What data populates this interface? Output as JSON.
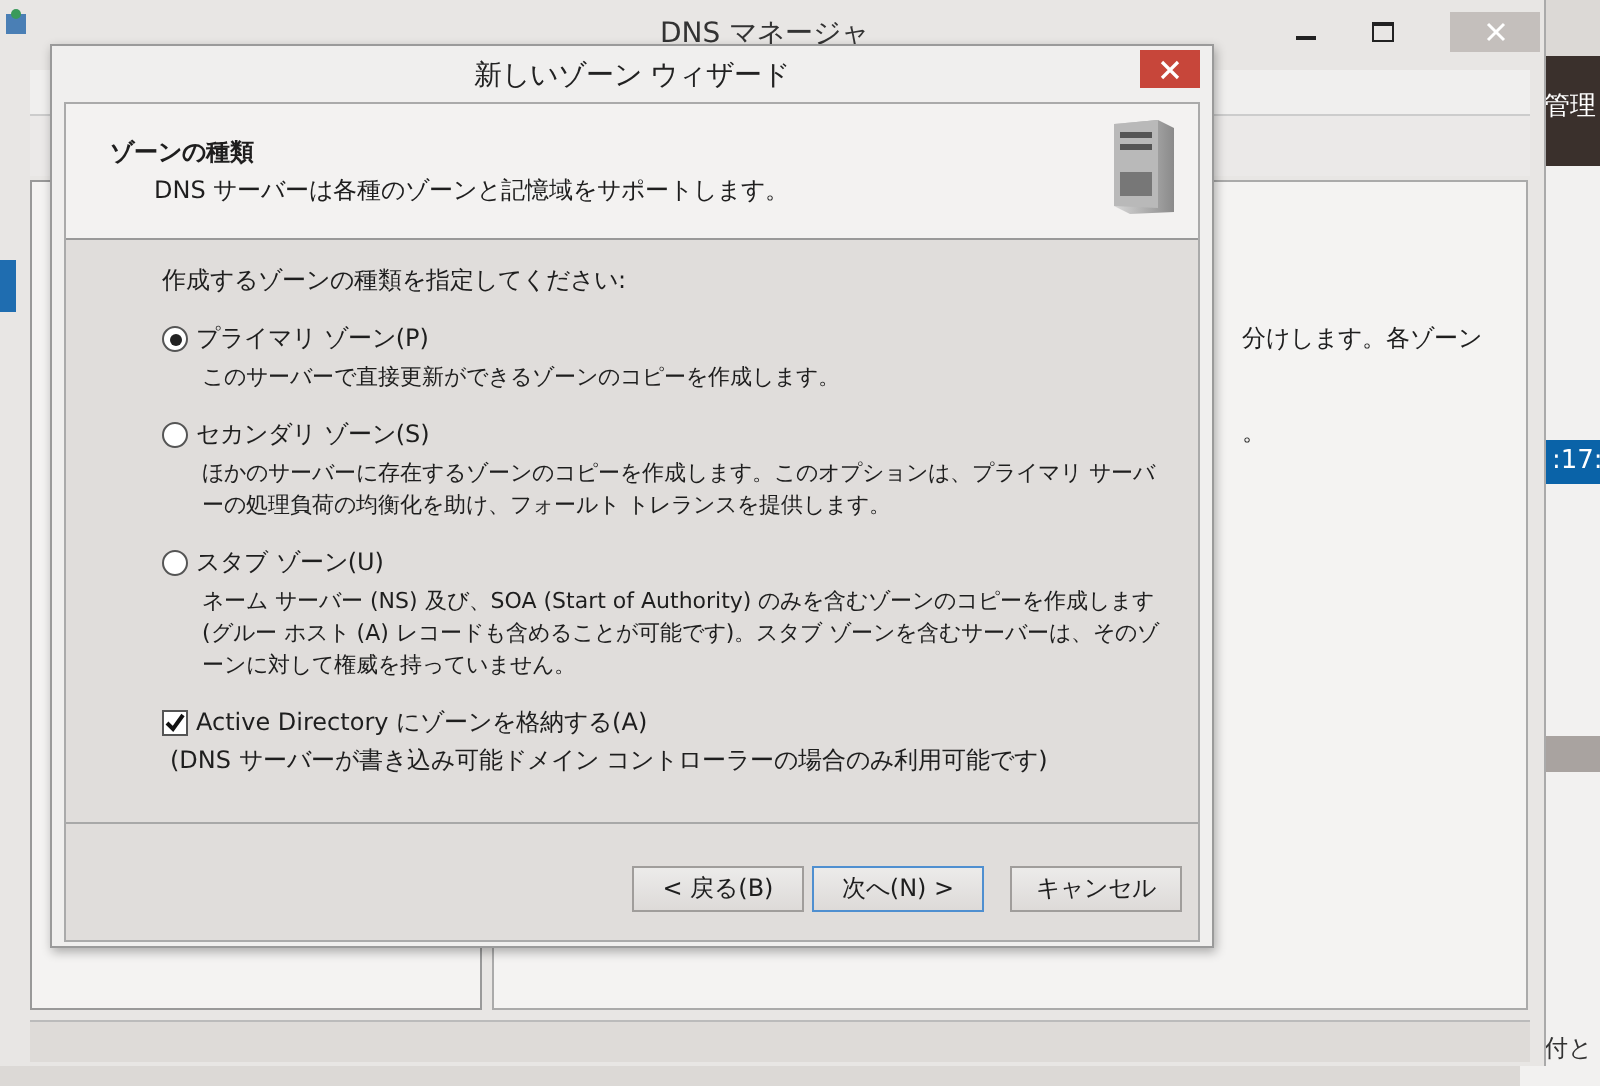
{
  "background_window": {
    "title": "DNS マネージャ",
    "menu_fragment": "管理",
    "text_lines": [
      "分けします。各ゾーン",
      "。"
    ]
  },
  "side_window": {
    "selected_cell": ":17:",
    "footer_text": "付と"
  },
  "dialog": {
    "title": "新しいゾーン ウィザード",
    "header": {
      "title": "ゾーンの種類",
      "subtitle": "DNS サーバーは各種のゾーンと記憶域をサポートします。"
    },
    "prompt": "作成するゾーンの種類を指定してください:",
    "zone_types": [
      {
        "label": "プライマリ ゾーン(P)",
        "description": "このサーバーで直接更新ができるゾーンのコピーを作成します。",
        "selected": true
      },
      {
        "label": "セカンダリ ゾーン(S)",
        "description": "ほかのサーバーに存在するゾーンのコピーを作成します。このオプションは、プライマリ サーバーの処理負荷の均衡化を助け、フォールト トレランスを提供します。",
        "selected": false
      },
      {
        "label": "スタブ ゾーン(U)",
        "description": "ネーム サーバー (NS) 及び、SOA (Start of Authority) のみを含むゾーンのコピーを作成します (グルー ホスト (A) レコードも含めることが可能です)。スタブ ゾーンを含むサーバーは、そのゾーンに対して権威を持っていません。",
        "selected": false
      }
    ],
    "store_in_ad": {
      "label": "Active Directory にゾーンを格納する(A)",
      "note": "(DNS サーバーが書き込み可能ドメイン コントローラーの場合のみ利用可能です)",
      "checked": true
    },
    "buttons": [
      {
        "label": "< 戻る(B)",
        "default": false
      },
      {
        "label": "次へ(N) >",
        "default": true
      },
      {
        "label": "キャンセル",
        "default": false
      }
    ]
  }
}
